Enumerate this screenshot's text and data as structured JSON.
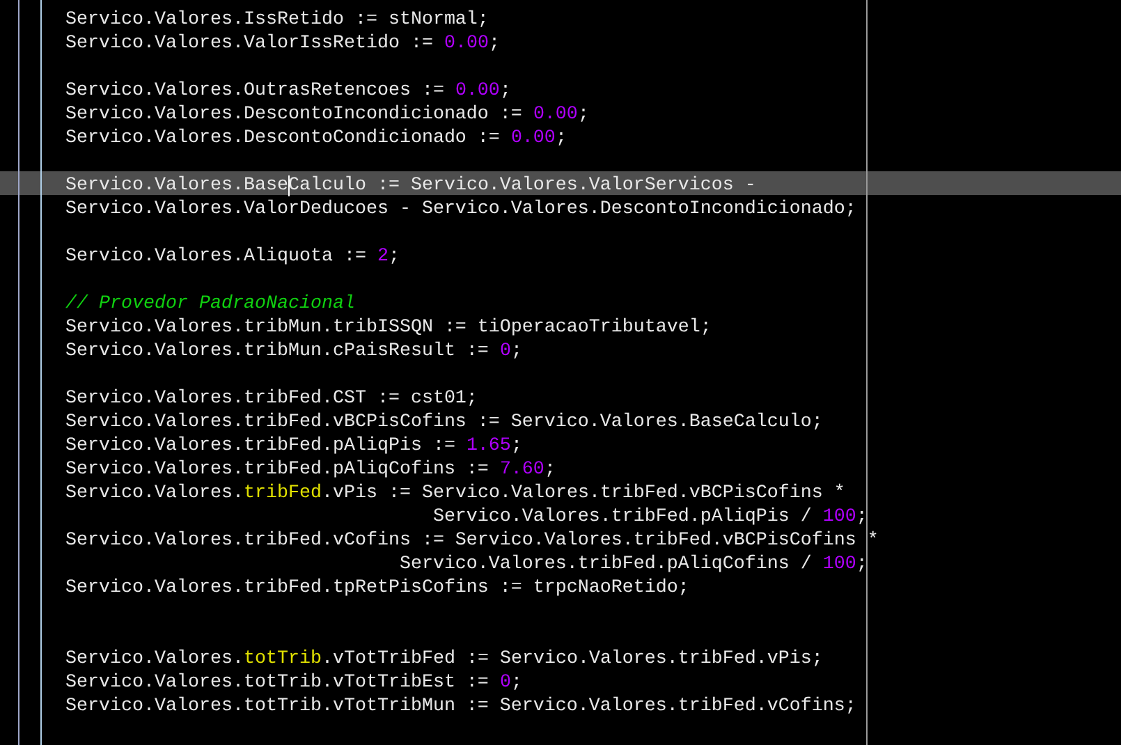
{
  "editor": {
    "lines": [
      {
        "kind": "code",
        "current": false,
        "segments": [
          {
            "kind": "plain",
            "text": "Servico.Valores.IssRetido := stNormal;"
          }
        ]
      },
      {
        "kind": "code",
        "current": false,
        "segments": [
          {
            "kind": "plain",
            "text": "Servico.Valores.ValorIssRetido := "
          },
          {
            "kind": "number",
            "text": "0.00"
          },
          {
            "kind": "plain",
            "text": ";"
          }
        ]
      },
      {
        "kind": "blank",
        "current": false
      },
      {
        "kind": "code",
        "current": false,
        "segments": [
          {
            "kind": "plain",
            "text": "Servico.Valores.OutrasRetencoes := "
          },
          {
            "kind": "number",
            "text": "0.00"
          },
          {
            "kind": "plain",
            "text": ";"
          }
        ]
      },
      {
        "kind": "code",
        "current": false,
        "segments": [
          {
            "kind": "plain",
            "text": "Servico.Valores.DescontoIncondicionado := "
          },
          {
            "kind": "number",
            "text": "0.00"
          },
          {
            "kind": "plain",
            "text": ";"
          }
        ]
      },
      {
        "kind": "code",
        "current": false,
        "segments": [
          {
            "kind": "plain",
            "text": "Servico.Valores.DescontoCondicionado := "
          },
          {
            "kind": "number",
            "text": "0.00"
          },
          {
            "kind": "plain",
            "text": ";"
          }
        ]
      },
      {
        "kind": "blank",
        "current": false
      },
      {
        "kind": "code",
        "current": true,
        "segments": [
          {
            "kind": "plain",
            "text": "Servico.Valores.Base",
            "caret": false
          },
          {
            "kind": "plain",
            "text": "Calculo := Servico.Valores.ValorServicos -",
            "caret": true
          }
        ]
      },
      {
        "kind": "code",
        "current": false,
        "segments": [
          {
            "kind": "plain",
            "text": "Servico.Valores.ValorDeducoes - Servico.Valores.DescontoIncondicionado;"
          }
        ]
      },
      {
        "kind": "blank",
        "current": false
      },
      {
        "kind": "code",
        "current": false,
        "segments": [
          {
            "kind": "plain",
            "text": "Servico.Valores.Aliquota := "
          },
          {
            "kind": "number",
            "text": "2"
          },
          {
            "kind": "plain",
            "text": ";"
          }
        ]
      },
      {
        "kind": "blank",
        "current": false
      },
      {
        "kind": "code",
        "current": false,
        "segments": [
          {
            "kind": "comment",
            "text": "// Provedor PadraoNacional"
          }
        ]
      },
      {
        "kind": "code",
        "current": false,
        "segments": [
          {
            "kind": "plain",
            "text": "Servico.Valores.tribMun.tribISSQN := tiOperacaoTributavel;"
          }
        ]
      },
      {
        "kind": "code",
        "current": false,
        "segments": [
          {
            "kind": "plain",
            "text": "Servico.Valores.tribMun.cPaisResult := "
          },
          {
            "kind": "number",
            "text": "0"
          },
          {
            "kind": "plain",
            "text": ";"
          }
        ]
      },
      {
        "kind": "blank",
        "current": false
      },
      {
        "kind": "code",
        "current": false,
        "segments": [
          {
            "kind": "plain",
            "text": "Servico.Valores.tribFed.CST := cst01;"
          }
        ]
      },
      {
        "kind": "code",
        "current": false,
        "segments": [
          {
            "kind": "plain",
            "text": "Servico.Valores.tribFed.vBCPisCofins := Servico.Valores.BaseCalculo;"
          }
        ]
      },
      {
        "kind": "code",
        "current": false,
        "segments": [
          {
            "kind": "plain",
            "text": "Servico.Valores.tribFed.pAliqPis := "
          },
          {
            "kind": "number",
            "text": "1.65"
          },
          {
            "kind": "plain",
            "text": ";"
          }
        ]
      },
      {
        "kind": "code",
        "current": false,
        "segments": [
          {
            "kind": "plain",
            "text": "Servico.Valores.tribFed.pAliqCofins := "
          },
          {
            "kind": "number",
            "text": "7.60"
          },
          {
            "kind": "plain",
            "text": ";"
          }
        ]
      },
      {
        "kind": "code",
        "current": false,
        "segments": [
          {
            "kind": "plain",
            "text": "Servico.Valores."
          },
          {
            "kind": "match",
            "text": "tribFed"
          },
          {
            "kind": "plain",
            "text": ".vPis := Servico.Valores.tribFed.vBCPisCofins *"
          }
        ]
      },
      {
        "kind": "code",
        "current": false,
        "segments": [
          {
            "kind": "plain",
            "text": "                                 Servico.Valores.tribFed.pAliqPis / "
          },
          {
            "kind": "number",
            "text": "100"
          },
          {
            "kind": "plain",
            "text": ";"
          }
        ]
      },
      {
        "kind": "code",
        "current": false,
        "segments": [
          {
            "kind": "plain",
            "text": "Servico.Valores.tribFed.vCofins := Servico.Valores.tribFed.vBCPisCofins *"
          }
        ]
      },
      {
        "kind": "code",
        "current": false,
        "segments": [
          {
            "kind": "plain",
            "text": "                              Servico.Valores.tribFed.pAliqCofins / "
          },
          {
            "kind": "number",
            "text": "100"
          },
          {
            "kind": "plain",
            "text": ";"
          }
        ]
      },
      {
        "kind": "code",
        "current": false,
        "segments": [
          {
            "kind": "plain",
            "text": "Servico.Valores.tribFed.tpRetPisCofins := trpcNaoRetido;"
          }
        ]
      },
      {
        "kind": "blank",
        "current": false
      },
      {
        "kind": "blank",
        "current": false
      },
      {
        "kind": "code",
        "current": false,
        "segments": [
          {
            "kind": "plain",
            "text": "Servico.Valores."
          },
          {
            "kind": "match",
            "text": "totTrib"
          },
          {
            "kind": "plain",
            "text": ".vTotTribFed := Servico.Valores.tribFed.vPis;"
          }
        ]
      },
      {
        "kind": "code",
        "current": false,
        "segments": [
          {
            "kind": "plain",
            "text": "Servico.Valores.totTrib.vTotTribEst := "
          },
          {
            "kind": "number",
            "text": "0"
          },
          {
            "kind": "plain",
            "text": ";"
          }
        ]
      },
      {
        "kind": "code",
        "current": false,
        "segments": [
          {
            "kind": "plain",
            "text": "Servico.Valores.totTrib.vTotTribMun := Servico.Valores.tribFed.vCofins;"
          }
        ]
      }
    ]
  }
}
